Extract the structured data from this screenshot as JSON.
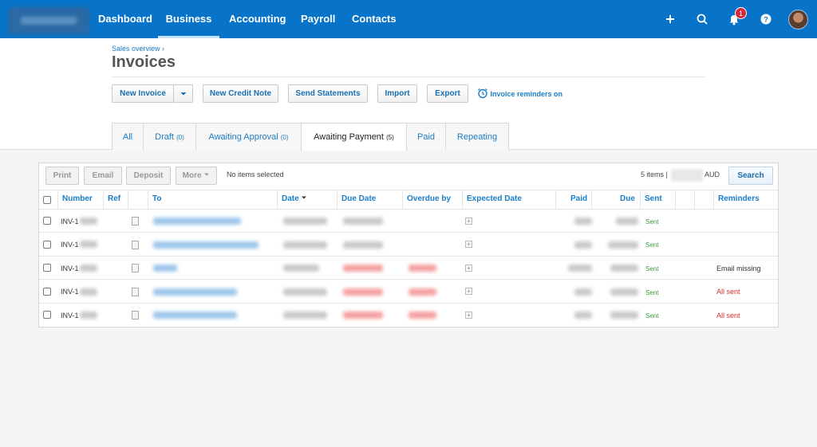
{
  "nav": {
    "links": [
      "Dashboard",
      "Business",
      "Accounting",
      "Payroll",
      "Contacts"
    ],
    "active": "Business",
    "notifications_count": "1"
  },
  "header": {
    "breadcrumb": "Sales overview",
    "breadcrumb_sep": "›",
    "title": "Invoices"
  },
  "actions": {
    "new_invoice": "New Invoice",
    "new_credit_note": "New Credit Note",
    "send_statements": "Send Statements",
    "import": "Import",
    "export": "Export",
    "reminders": "Invoice reminders on"
  },
  "tabs": [
    {
      "label": "All",
      "count": ""
    },
    {
      "label": "Draft",
      "count": "(0)"
    },
    {
      "label": "Awaiting Approval",
      "count": "(0)"
    },
    {
      "label": "Awaiting Payment",
      "count": "(5)"
    },
    {
      "label": "Paid",
      "count": ""
    },
    {
      "label": "Repeating",
      "count": ""
    }
  ],
  "active_tab": "Awaiting Payment",
  "toolbar": {
    "print": "Print",
    "email": "Email",
    "deposit": "Deposit",
    "more": "More",
    "selection": "No items selected",
    "count": "5 items",
    "count_sep": "|",
    "currency": "AUD",
    "search": "Search"
  },
  "table": {
    "headers": {
      "number": "Number",
      "ref": "Ref",
      "to": "To",
      "date": "Date",
      "due_date": "Due Date",
      "overdue_by": "Overdue by",
      "expected_date": "Expected Date",
      "paid": "Paid",
      "due": "Due",
      "sent": "Sent",
      "reminders": "Reminders"
    },
    "rows": [
      {
        "number": "INV-1",
        "sent": "Sent",
        "reminders": "",
        "overdue": false
      },
      {
        "number": "INV-1",
        "sent": "Sent",
        "reminders": "",
        "overdue": false
      },
      {
        "number": "INV-1",
        "sent": "Sent",
        "reminders": "Email missing",
        "overdue": true
      },
      {
        "number": "INV-1",
        "sent": "Sent",
        "reminders": "All sent",
        "overdue": true
      },
      {
        "number": "INV-1",
        "sent": "Sent",
        "reminders": "All sent",
        "overdue": true
      }
    ]
  },
  "colors": {
    "nav": "#0874c9",
    "link": "#1a7dc7",
    "sent": "#3a9a3a",
    "alert": "#d32f2f"
  }
}
